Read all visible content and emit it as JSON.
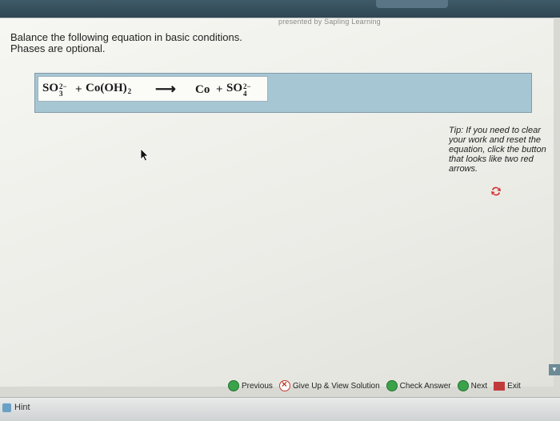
{
  "header": {
    "breadcrumb": "",
    "credit": "presented by Sapling Learning",
    "right_text": ""
  },
  "question": {
    "line1": "Balance the following equation in basic conditions.",
    "line2": "Phases are optional."
  },
  "equation": {
    "r1_formula": "SO",
    "r1_sub": "3",
    "r1_charge": "2−",
    "plus1": "+",
    "r2_formula": "Co(OH)",
    "r2_sub": "2",
    "arrow": "⟶",
    "p1": "Co",
    "plus2": "+",
    "p2_formula": "SO",
    "p2_sub": "4",
    "p2_charge": "2−"
  },
  "tip": "Tip: If you need to clear your work and reset the equation, click the button that looks like two red arrows.",
  "nav": {
    "previous": "Previous",
    "give_up": "Give Up & View Solution",
    "check": "Check Answer",
    "next": "Next",
    "exit": "Exit"
  },
  "footer": {
    "hint": "Hint"
  },
  "colors": {
    "equation_box": "#a7c6d3",
    "topbar": "#2f4654",
    "green": "#3aa34a",
    "red": "#c0392b"
  }
}
